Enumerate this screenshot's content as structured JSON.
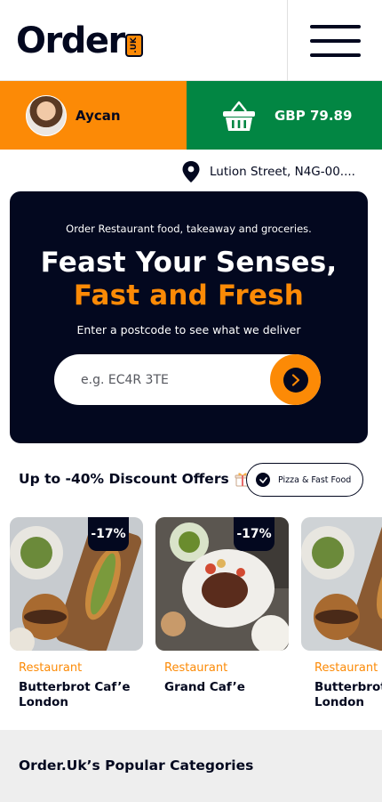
{
  "header": {
    "logo_word": "Order",
    "logo_badge": ".UK"
  },
  "user": {
    "name": "Aycan"
  },
  "basket": {
    "amount": "GBP 79.89"
  },
  "location": {
    "address": "Lution Street, N4G-00...."
  },
  "hero": {
    "tagline": "Order Restaurant food, takeaway and groceries.",
    "title_line1": "Feast Your Senses,",
    "title_line2": "Fast and Fresh",
    "subtitle": "Enter a postcode to see what we deliver",
    "search_placeholder": "e.g. EC4R 3TE"
  },
  "offers": {
    "title": "Up to -40% Discount Offers",
    "filter_label": "Pizza & Fast Food",
    "cards": [
      {
        "discount": "-17%",
        "category": "Restaurant",
        "name": "Butterbrot Caf’e\nLondon"
      },
      {
        "discount": "-17%",
        "category": "Restaurant",
        "name": "Grand Caf’e"
      },
      {
        "discount": "",
        "category": "Restaurant",
        "name": "Butterbrot Caf’e\nLondon"
      }
    ]
  },
  "categories": {
    "title": "Order.Uk’s Popular Categories"
  },
  "colors": {
    "orange": "#FC8A06",
    "green": "#028643",
    "navy": "#03081F",
    "light_gray": "#EEEEEE"
  }
}
